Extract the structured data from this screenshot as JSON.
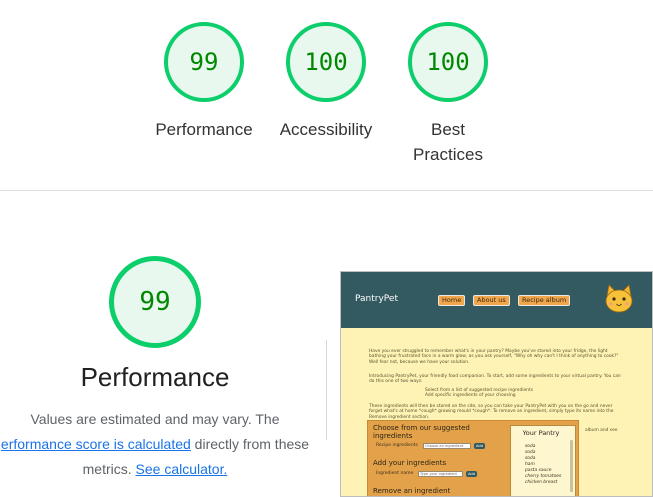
{
  "summary": {
    "scores": [
      {
        "value": "99",
        "label": "Performance"
      },
      {
        "value": "100",
        "label": "Accessibility"
      },
      {
        "value": "100",
        "label": "Best Practices",
        "label_line1": "Best",
        "label_line2": "Practices"
      }
    ]
  },
  "detail": {
    "score": "99",
    "title": "Performance",
    "note_line1": "Values are estimated and may vary. The",
    "note_link": "erformance score is calculated",
    "note_after_link": " directly from these",
    "note_line3_prefix": "metrics. ",
    "note_calc_link": "See calculator.",
    "score_color": "#0cce6b",
    "score_text_color": "#008800"
  },
  "screenshot": {
    "brand": "PantryPet",
    "nav": [
      "Home",
      "About us",
      "Recipe album"
    ],
    "intro_1": "Have you ever struggled to remember what's in your pantry? Maybe you've stared into your fridge, the light bathing your frustrated face in a warm glow, as you ask yourself, \"Why oh why can't I think of anything to cook?\" Well fear not, because we have your solution.",
    "intro_2": "Introducing PantryPet, your friendly food companion. To start, add some ingredients to your virtual pantry. You can do this one of two ways:",
    "bullet_1": "Select from a list of suggested recipe ingredients",
    "bullet_2": "Add specific ingredients of your choosing",
    "intro_3": "These ingredients will then be stored on the site, so you can take your PantryPet with you on the go and never forget what's at home *cough* growing mould *cough*. To remove an ingredient, simply type its name into the Remove ingredient section.",
    "side_text": "album and see",
    "choose_heading": "Choose from our suggested ingredients",
    "recipe_label": "Recipe ingredients",
    "recipe_select": "Choose an ingredient",
    "add_label": "Add",
    "add_heading": "Add your ingredients",
    "ingredient_label": "Ingredient name",
    "ingredient_placeholder": "Type your ingredient",
    "remove_heading": "Remove an ingredient",
    "pantry_title": "Your Pantry",
    "pantry_items": [
      "soda",
      "soda",
      "soda",
      "ham",
      "pasta sauce",
      "cherry tomatoes",
      "chicken breast"
    ]
  }
}
